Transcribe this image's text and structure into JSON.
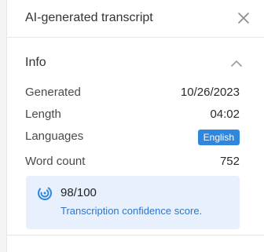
{
  "header": {
    "title": "AI-generated transcript",
    "close_icon": "close-icon"
  },
  "info": {
    "title": "Info",
    "collapse_icon": "chevron-up-icon",
    "rows": [
      {
        "label": "Generated",
        "value": "10/26/2023"
      },
      {
        "label": "Length",
        "value": "04:02"
      },
      {
        "label": "Languages",
        "value": "English"
      },
      {
        "label": "Word count",
        "value": "752"
      }
    ]
  },
  "confidence": {
    "score": "98/100",
    "description": "Transcription confidence score.",
    "icon": "signal-icon"
  },
  "colors": {
    "accent": "#2f86dd",
    "callout_bg": "#e8f0fd",
    "link": "#2f76c9"
  }
}
